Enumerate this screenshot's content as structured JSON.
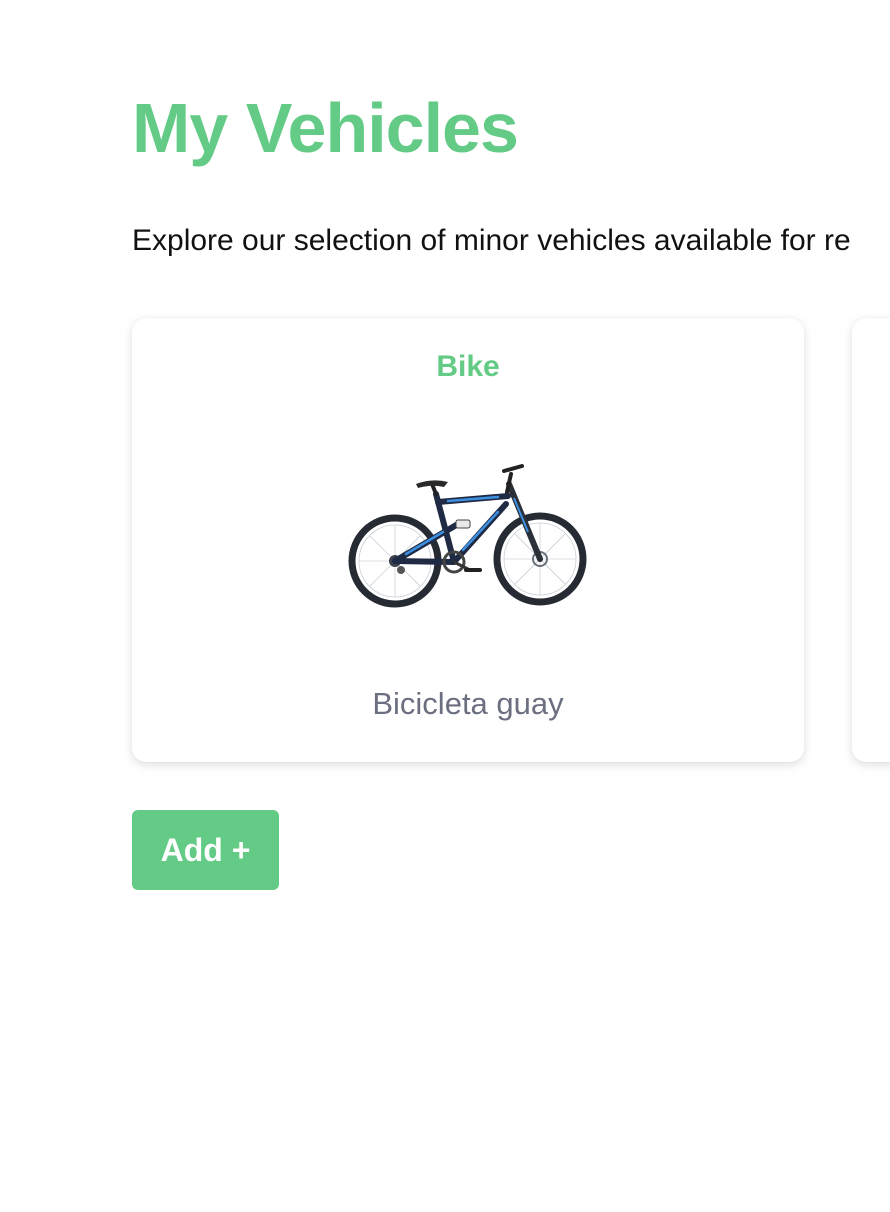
{
  "header": {
    "title": "My Vehicles",
    "intro": "Explore our selection of minor vehicles available for re"
  },
  "vehicles": [
    {
      "name": "Bike",
      "description": "Bicicleta guay",
      "image_icon": "mountain-bike-image"
    }
  ],
  "actions": {
    "add_label": "Add +"
  },
  "colors": {
    "accent": "#63cb86",
    "description_text": "#6b6f80",
    "body_text": "#111111",
    "bike_frame": "#1f2a44",
    "bike_accent": "#3d8fe0"
  }
}
